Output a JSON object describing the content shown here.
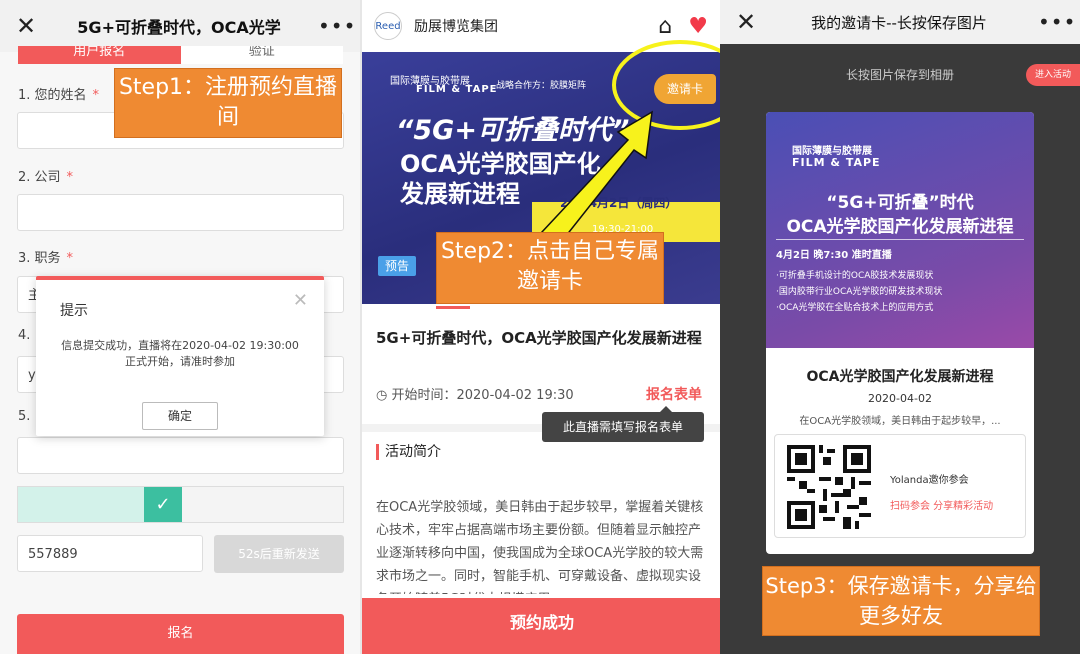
{
  "panel1": {
    "title": "5G+可折叠时代，OCA光学",
    "close": "✕",
    "more": "•••",
    "tabs": [
      "用户报名",
      "验证"
    ],
    "fields": [
      {
        "label": "1. 您的姓名",
        "required": "*",
        "value": ""
      },
      {
        "label": "2. 公司",
        "required": "*",
        "value": ""
      },
      {
        "label": "3. 职务",
        "required": "*",
        "value": "主"
      },
      {
        "label": "4.",
        "value": "yo"
      },
      {
        "label": "5.",
        "value": ""
      }
    ],
    "verify_code": "557889",
    "resend": "52s后重新发送",
    "slider_check": "✓",
    "submit": "报名",
    "modal": {
      "title": "提示",
      "body": "信息提交成功，直播将在2020-04-02 19:30:00正式开始，请准时参加",
      "ok": "确定",
      "close": "✕"
    },
    "callout": "Step1：注册预约直播间"
  },
  "panel2": {
    "org_name": "励展博览集团",
    "logo": "Reed",
    "banner": {
      "exhibition": "国际薄膜与胶带展",
      "film_tape": "FILM & TAPE",
      "partner": "战略合作方：胶膜矩阵",
      "headline": "“5G+可折叠时代”",
      "line2": "OCA光学胶国产化",
      "line3": "发展新进程",
      "date": "20年4月2日（周四）",
      "time": "19:30-21:00"
    },
    "invite_card": "邀请卡",
    "tag": "预告",
    "callout": "Step2：点击自己专属邀请卡",
    "event_title": "5G+可折叠时代，OCA光学胶国产化发展新进程",
    "start_label": "开始时间：2020-04-02 19:30",
    "form_link": "报名表单",
    "tooltip": "此直播需填写报名表单",
    "intro_heading": "活动简介",
    "intro_text": "在OCA光学胶领域，美日韩由于起步较早，掌握着关键核心技术，牢牢占据高端市场主要份额。但随着显示触控产业逐渐转移向中国，使我国成为全球OCA光学胶的较大需求市场之一。同时，智能手机、可穿戴设备、虚拟现实设备开始随着5G时代大规模应用",
    "success_btn": "预约成功"
  },
  "panel3": {
    "title": "我的邀请卡--长按保存图片",
    "close": "✕",
    "more": "•••",
    "hint": "长按图片保存到相册",
    "enter_activity": "进入活动",
    "card": {
      "exhibition": "国际薄膜与胶带展",
      "film_tape": "FILM & TAPE",
      "headline1": "“5G+可折叠”时代",
      "headline2": "OCA光学胶国产化发展新进程",
      "schedule": "4月2日 晚7:30 准时直播",
      "bullets": [
        "·可折叠手机设计的OCA胶技术发展现状",
        "·国内胶带行业OCA光学胶的研发技术现状",
        "·OCA光学胶在全贴合技术上的应用方式"
      ],
      "title": "OCA光学胶国产化发展新进程",
      "date": "2020-04-02",
      "desc": "在OCA光学胶领域，美日韩由于起步较早，...",
      "inviter": "Yolanda邀你参会",
      "scan_share": "扫码参会 分享精彩活动"
    },
    "callout": "Step3：保存邀请卡，分享给更多好友"
  },
  "colors": {
    "brand_red": "#f25a5a",
    "callout_orange": "#ef8a32",
    "highlight_yellow": "#f7f21c",
    "banner_blue": "#2a2e7c"
  }
}
